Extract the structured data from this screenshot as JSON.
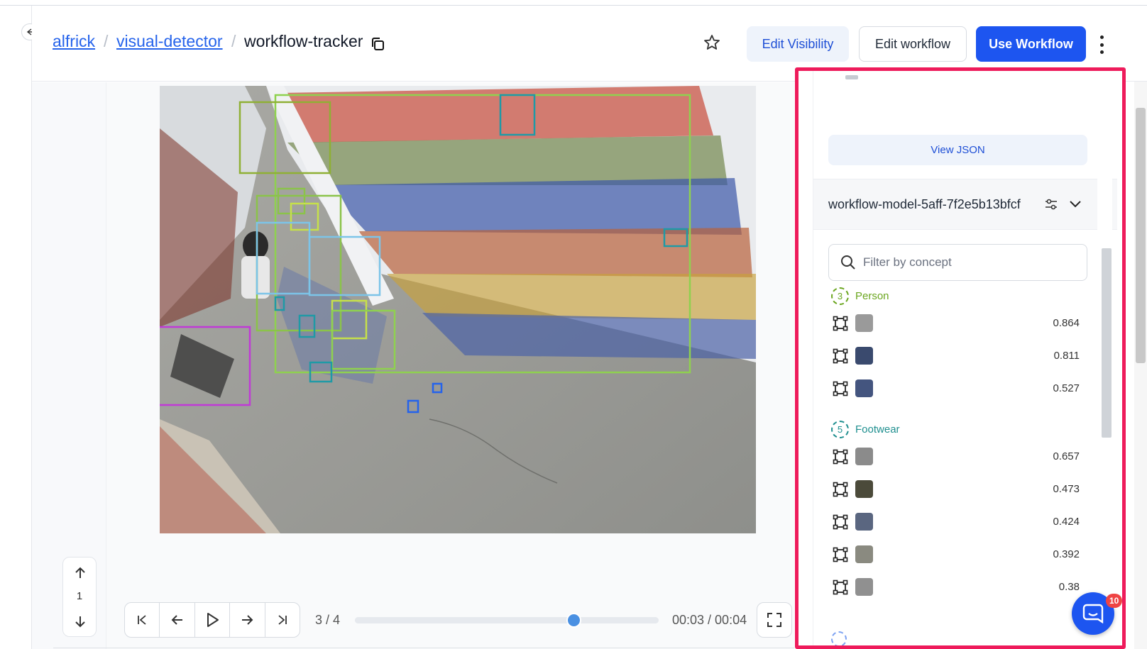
{
  "breadcrumb": {
    "owner": "alfrick",
    "sep1": "/",
    "app": "visual-detector",
    "sep2": "/",
    "current": "workflow-tracker"
  },
  "header_actions": {
    "edit_visibility": "Edit Visibility",
    "edit_workflow": "Edit workflow",
    "use_workflow": "Use Workflow"
  },
  "icons": {
    "copy": "copy-icon",
    "star": "star-icon",
    "more": "kebab-menu-icon",
    "collapse": "arrow-left-icon",
    "search": "search-icon",
    "filter": "sliders-icon",
    "chevron": "chevron-down-icon",
    "bbox": "bounding-box-icon",
    "fullscreen": "fullscreen-icon",
    "chat": "chat-icon"
  },
  "colors": {
    "primary": "#1d55f0",
    "highlight_border": "#ee1b5b",
    "person": "#6ba61f",
    "footwear": "#1f8f8f"
  },
  "player": {
    "frame_counter": "3 / 4",
    "time_display": "00:03 / 00:04",
    "progress": 0.72
  },
  "pager": {
    "page": "1"
  },
  "panel": {
    "view_json": "View JSON",
    "model_name": "workflow-model-5aff-7f2e5b13bfcf",
    "filter_placeholder": "Filter by concept",
    "groups": [
      {
        "label": "Person",
        "count": "3",
        "color": "#6ba61f",
        "items": [
          {
            "score": "0.864",
            "thumb": "#9a9a9a"
          },
          {
            "score": "0.811",
            "thumb": "#3a4a6e"
          },
          {
            "score": "0.527",
            "thumb": "#44557f"
          }
        ]
      },
      {
        "label": "Footwear",
        "count": "5",
        "color": "#1f8f8f",
        "items": [
          {
            "score": "0.657",
            "thumb": "#8b8b8b"
          },
          {
            "score": "0.473",
            "thumb": "#4b4a3a"
          },
          {
            "score": "0.424",
            "thumb": "#5a6680"
          },
          {
            "score": "0.392",
            "thumb": "#8a8a80"
          },
          {
            "score": "0.38",
            "thumb": "#909090"
          }
        ]
      }
    ]
  },
  "chat": {
    "badge": "10"
  }
}
